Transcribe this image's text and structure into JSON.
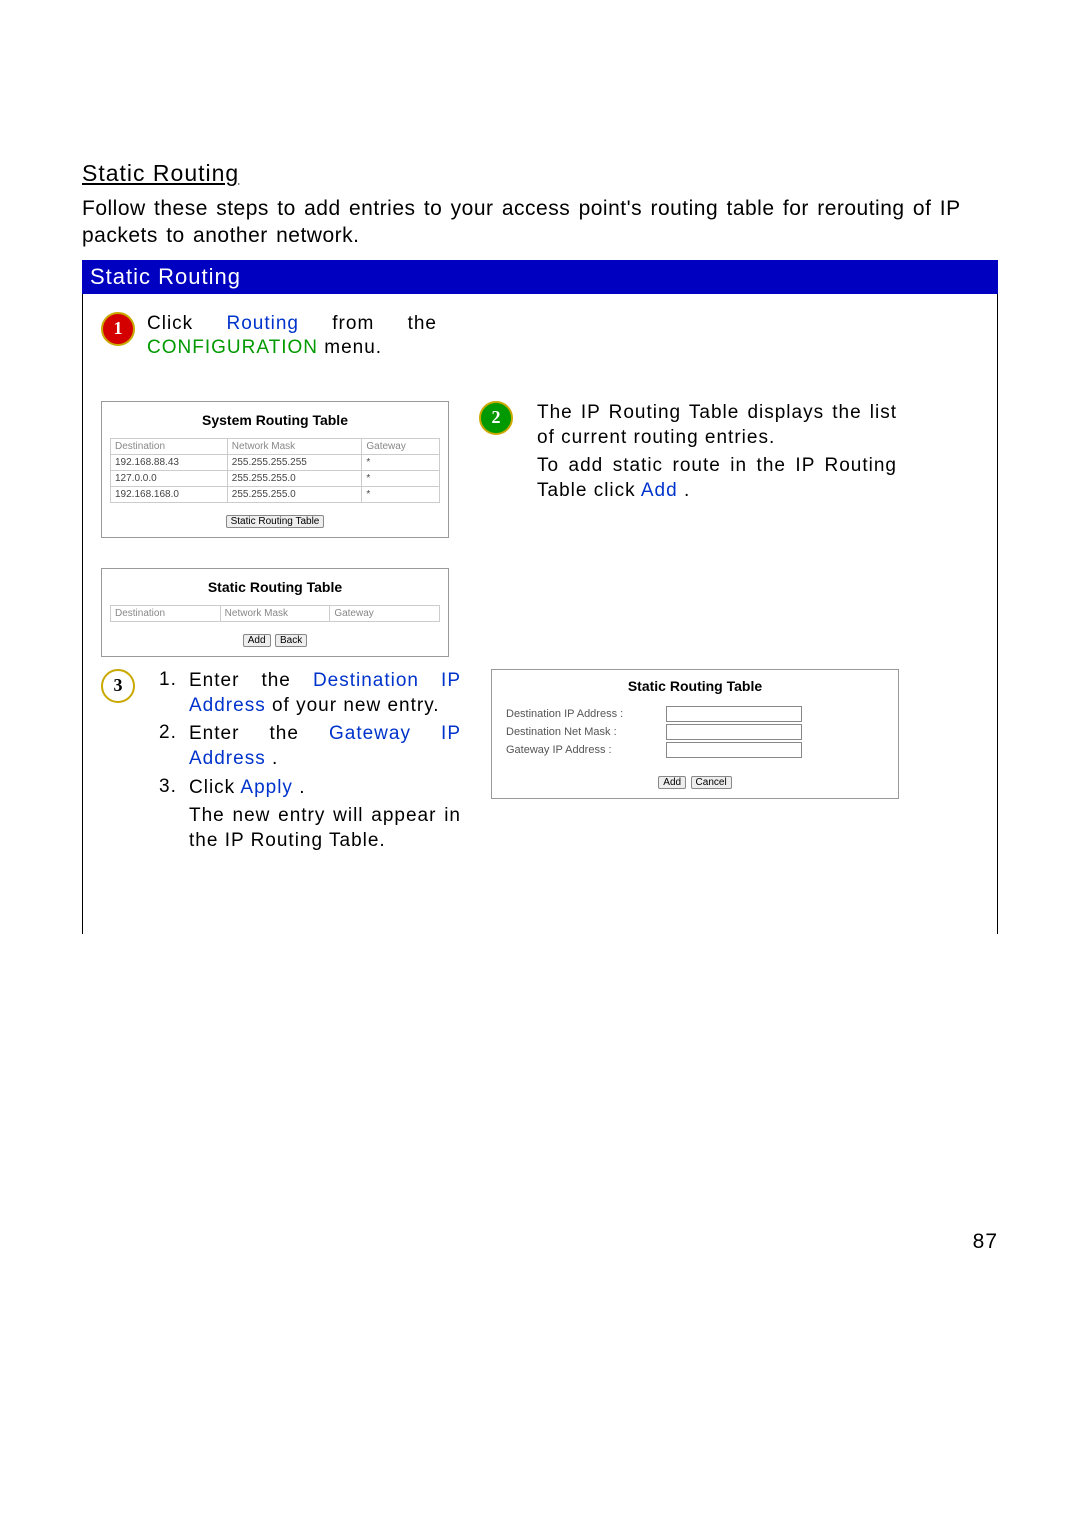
{
  "page": {
    "section_title": "Static Routing",
    "intro": "Follow these steps to add entries to your access point's routing table for rerouting of IP packets to another network.",
    "banner": "Static Routing",
    "page_number": "87"
  },
  "step1": {
    "num": "1",
    "t1": "Click ",
    "link1": "Routing",
    "t2": " from the ",
    "link2": "CONFIGURATION",
    "t3": " menu."
  },
  "system_table": {
    "title": "System Routing Table",
    "headers": {
      "h1": "Destination",
      "h2": "Network Mask",
      "h3": "Gateway"
    },
    "rows": [
      {
        "dest": "192.168.88.43",
        "mask": "255.255.255.255",
        "gw": "*"
      },
      {
        "dest": "127.0.0.0",
        "mask": "255.255.255.0",
        "gw": "*"
      },
      {
        "dest": "192.168.168.0",
        "mask": "255.255.255.0",
        "gw": "*"
      }
    ],
    "btn": "Static Routing Table"
  },
  "step2": {
    "num": "2",
    "line1": "The IP Routing Table displays the list of current routing entries.",
    "line2a": "To add static route in the IP Routing Table click ",
    "link": "Add",
    "line2b": "."
  },
  "static_table": {
    "title": "Static Routing Table",
    "headers": {
      "h1": "Destination",
      "h2": "Network Mask",
      "h3": "Gateway"
    },
    "btn_add": "Add",
    "btn_back": "Back"
  },
  "step3": {
    "num": "3",
    "items": [
      {
        "n": "1.",
        "t1": "Enter the ",
        "link": "Destination IP Address",
        "t2": " of your new entry."
      },
      {
        "n": "2.",
        "t1": "Enter the ",
        "link": "Gateway IP Address",
        "t2": "."
      },
      {
        "n": "3.",
        "t1": "Click ",
        "link": "Apply",
        "t2": "."
      }
    ],
    "extra": "The new entry will appear in the IP Routing Table."
  },
  "form_panel": {
    "title": "Static Routing Table",
    "f1": "Destination IP Address :",
    "f2": "Destination Net Mask :",
    "f3": "Gateway IP Address :",
    "btn_add": "Add",
    "btn_cancel": "Cancel"
  }
}
